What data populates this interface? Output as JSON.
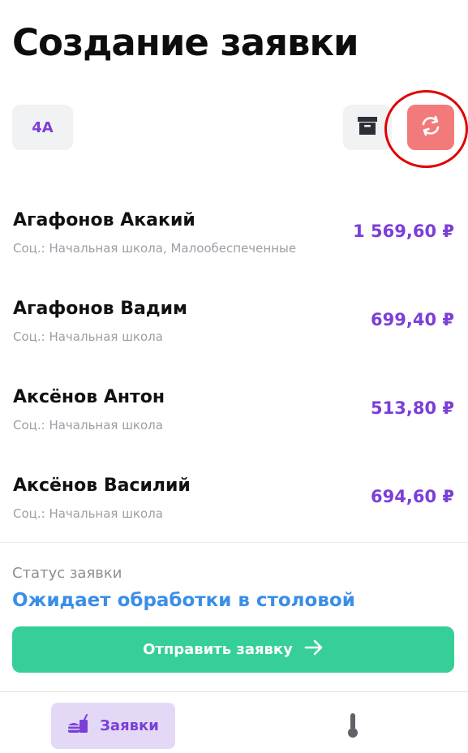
{
  "header": {
    "title": "Создание заявки"
  },
  "toolbar": {
    "class_label": "4А",
    "archive_icon": "archive-icon",
    "refresh_icon": "refresh-icon"
  },
  "students": [
    {
      "name": "Агафонов Акакий",
      "meta": "Соц.: Начальная школа, Малообеспеченные",
      "amount": "1 569,60 ₽"
    },
    {
      "name": "Агафонов Вадим",
      "meta": "Соц.: Начальная школа",
      "amount": "699,40 ₽"
    },
    {
      "name": "Аксёнов Антон",
      "meta": "Соц.: Начальная школа",
      "amount": "513,80 ₽"
    },
    {
      "name": "Аксёнов Василий",
      "meta": "Соц.: Начальная школа",
      "amount": "694,60 ₽"
    }
  ],
  "status": {
    "label": "Статус заявки",
    "value": "Ожидает обработки в столовой"
  },
  "submit": {
    "label": "Отправить заявку"
  },
  "nav": {
    "requests_label": "Заявки",
    "requests_icon": "food-drink-icon",
    "temperature_icon": "thermometer-icon"
  },
  "colors": {
    "accent_purple": "#7b3fd8",
    "refresh_red": "#f37a7a",
    "submit_green": "#35cf97",
    "status_blue": "#3a8ee6",
    "highlight": "#e00000"
  }
}
